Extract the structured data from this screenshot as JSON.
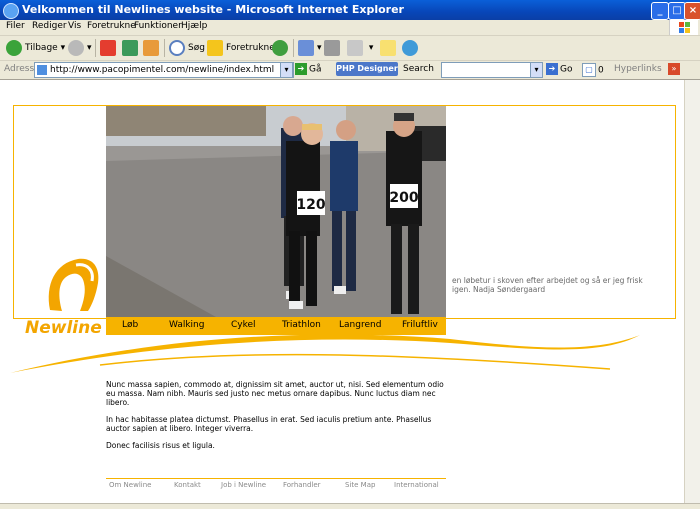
{
  "window": {
    "title": "Velkommen til Newlines website - Microsoft Internet Explorer"
  },
  "menu": [
    "Filer",
    "Rediger",
    "Vis",
    "Foretrukne",
    "Funktioner",
    "Hjælp"
  ],
  "toolbar": {
    "back": "Tilbage",
    "search": "Søg",
    "favorites": "Foretrukne"
  },
  "address": {
    "label": "Adresse",
    "url": "http://www.pacopimentel.com/newline/index.html",
    "go": "Gå",
    "php_designer": "PHP Designer",
    "search_label": "Search",
    "search_go": "Go",
    "counter": "0",
    "hyperlinks": "Hyperlinks"
  },
  "site": {
    "logo_text": "Newline",
    "nav": [
      "Løb",
      "Walking",
      "Cykel",
      "Triathlon",
      "Langrend",
      "Friluftliv"
    ],
    "photo_caption": "en løbetur i skoven efter arbejdet og så er jeg frisk igen. Nadja Søndergaard",
    "runner_bibs": [
      "120",
      "200"
    ],
    "paragraphs": [
      "Nunc massa sapien, commodo at, dignissim sit amet, auctor ut, nisi. Sed elementum odio eu massa. Nam nibh. Mauris sed justo nec metus ornare dapibus. Nunc luctus diam nec libero.",
      "In hac habitasse platea dictumst. Phasellus in erat. Sed iaculis pretium ante. Phasellus auctor sapien at libero. Integer viverra.",
      "Donec facilisis risus et ligula."
    ],
    "footer": [
      "Om Newline",
      "Kontakt",
      "Job i Newline",
      "Forhandler",
      "Site Map",
      "International"
    ]
  },
  "colors": {
    "accent": "#f6b300",
    "titlebar": "#0a5fd8"
  }
}
